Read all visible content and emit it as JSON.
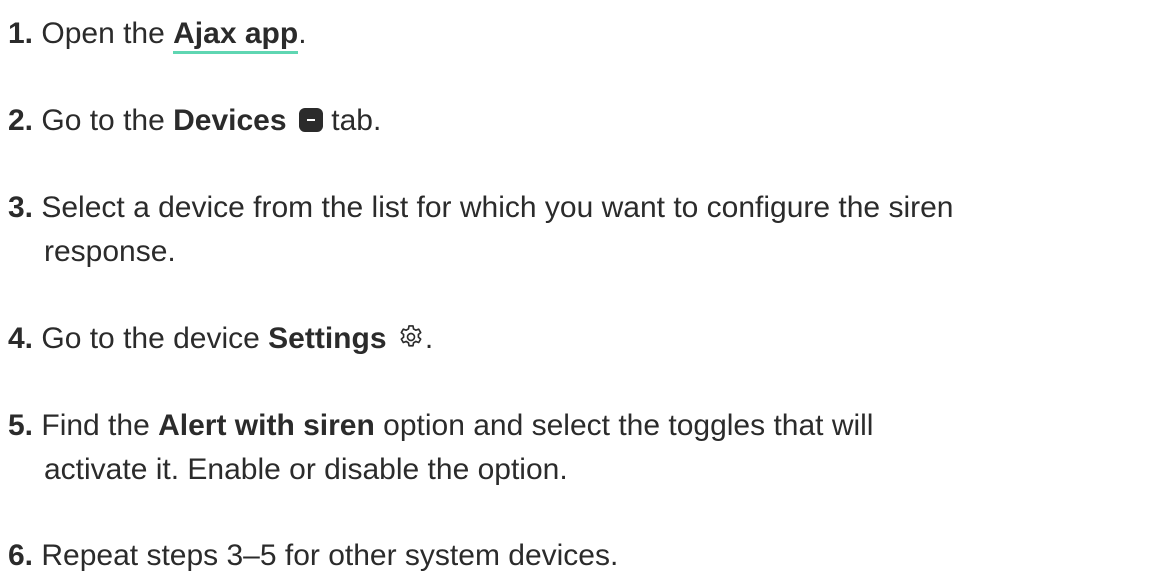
{
  "steps": [
    {
      "num": "1.",
      "pre": " Open the ",
      "link": "Ajax app",
      "post": "."
    },
    {
      "num": "2.",
      "pre": " Go to the ",
      "bold": "Devices",
      "icon": "devices-tab-icon",
      "post": " tab."
    },
    {
      "num": "3.",
      "line1": " Select a device from the list for which you want to configure the siren",
      "line2": "response."
    },
    {
      "num": "4.",
      "pre": " Go to the device ",
      "bold": "Settings",
      "icon": "gear-icon",
      "post": "."
    },
    {
      "num": "5.",
      "pre": " Find the ",
      "bold": "Alert with siren",
      "post": " option and select the toggles that will",
      "line2": "activate it. Enable or disable the option."
    },
    {
      "num": "6.",
      "text": " Repeat steps 3–5 for other system devices."
    }
  ],
  "colors": {
    "text": "#2b2b2b",
    "link_underline": "#5fd6b2"
  }
}
